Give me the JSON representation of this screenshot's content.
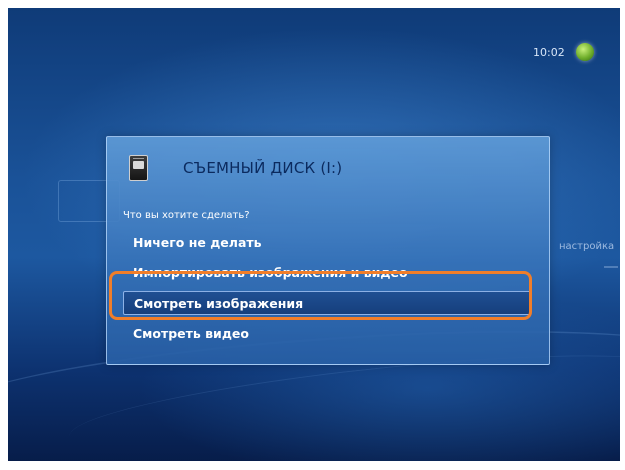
{
  "status_bar": {
    "time": "10:02",
    "logo_icon": "windows-media-center-orb-icon"
  },
  "background": {
    "settings_label": "настройка"
  },
  "dialog": {
    "title": "СЪЕМНЫЙ ДИСК (I:)",
    "icon": "removable-disk-icon",
    "prompt": "Что вы хотите сделать?",
    "options": [
      {
        "label": "Ничего не делать",
        "selected": false
      },
      {
        "label": "Импортировать изображения и видео",
        "selected": false
      },
      {
        "label": "Смотреть изображения",
        "selected": true
      },
      {
        "label": "Смотреть видео",
        "selected": false
      }
    ]
  },
  "colors": {
    "highlight": "#f07e2a",
    "background": "#1a5298",
    "title_text": "#0b2a5e"
  }
}
